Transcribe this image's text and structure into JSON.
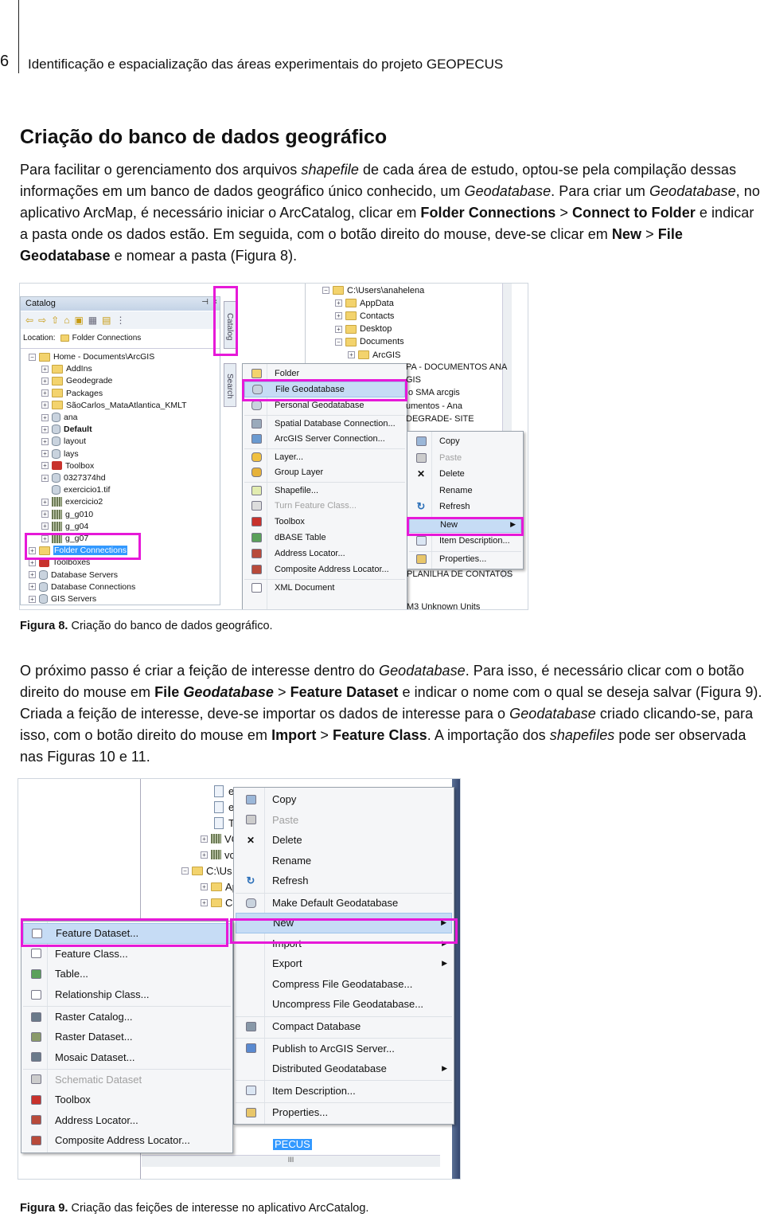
{
  "header": {
    "page_number": "6",
    "running_title": "Identificação e espacialização das áreas experimentais do projeto GEOPECUS"
  },
  "section_title": "Criação do banco de dados geográfico",
  "paragraph1": [
    {
      "t": "Para facilitar o gerenciamento dos arquivos ",
      "s": ""
    },
    {
      "t": "shapefile",
      "s": "i"
    },
    {
      "t": " de cada área de estudo, optou-se pela compilação dessas informações em um banco de dados geográfico único conhecido, um ",
      "s": ""
    },
    {
      "t": "Geodatabase",
      "s": "i"
    },
    {
      "t": ". Para criar um ",
      "s": ""
    },
    {
      "t": "Geodatabase",
      "s": "i"
    },
    {
      "t": ", no aplicativo ArcMap, é necessário iniciar o ArcCatalog, clicar em ",
      "s": ""
    },
    {
      "t": "Folder Connections",
      "s": "b"
    },
    {
      "t": " > ",
      "s": ""
    },
    {
      "t": "Connect to Folder",
      "s": "b"
    },
    {
      "t": " e indicar a pasta onde os dados estão. Em seguida, com o botão direito do mouse, deve-se clicar em ",
      "s": ""
    },
    {
      "t": "New",
      "s": "b"
    },
    {
      "t": " > ",
      "s": ""
    },
    {
      "t": "File Geodatabase",
      "s": "b"
    },
    {
      "t": " e nomear a pasta (Figura 8).",
      "s": ""
    }
  ],
  "paragraph2": [
    {
      "t": "O próximo passo é criar a feição de interesse dentro do ",
      "s": ""
    },
    {
      "t": "Geodatabase",
      "s": "i"
    },
    {
      "t": ". Para isso, é necessário clicar com o botão direito do mouse em ",
      "s": ""
    },
    {
      "t": "File ",
      "s": "b"
    },
    {
      "t": "Geodatabase",
      "s": "bi"
    },
    {
      "t": " > ",
      "s": ""
    },
    {
      "t": "Feature Dataset",
      "s": "b"
    },
    {
      "t": " e indicar o nome com o qual se deseja salvar (Figura 9). Criada a feição de interesse, deve-se importar os dados de interesse para o ",
      "s": ""
    },
    {
      "t": "Geodatabase",
      "s": "i"
    },
    {
      "t": " criado clicando-se, para isso, com o botão direito do mouse em ",
      "s": ""
    },
    {
      "t": "Import",
      "s": "b"
    },
    {
      "t": " > ",
      "s": ""
    },
    {
      "t": "Feature Class",
      "s": "b"
    },
    {
      "t": ". A importação dos ",
      "s": ""
    },
    {
      "t": "shapefiles",
      "s": "i"
    },
    {
      "t": " pode ser observada nas Figuras 10 e 11.",
      "s": ""
    }
  ],
  "figure8": {
    "caption_label": "Figura 8.",
    "caption_text": " Criação do banco de dados geográfico.",
    "catalog": {
      "title": "Catalog",
      "location_label": "Location:",
      "location_value": "Folder Connections",
      "tab_catalog": "Catalog",
      "tab_search": "Search",
      "tree": [
        {
          "label": "Home - Documents\\ArcGIS",
          "icon": "home-folder",
          "exp": "-",
          "lvl": 0
        },
        {
          "label": "AddIns",
          "icon": "folder",
          "exp": "+",
          "lvl": 1
        },
        {
          "label": "Geodegrade",
          "icon": "folder",
          "exp": "+",
          "lvl": 1
        },
        {
          "label": "Packages",
          "icon": "folder",
          "exp": "+",
          "lvl": 1
        },
        {
          "label": "SãoCarlos_MataAtlantica_KMLT",
          "icon": "folder",
          "exp": "+",
          "lvl": 1
        },
        {
          "label": "ana",
          "icon": "geodatabase",
          "exp": "+",
          "lvl": 1
        },
        {
          "label": "Default",
          "icon": "geodatabase",
          "exp": "+",
          "lvl": 1,
          "bold": true
        },
        {
          "label": "layout",
          "icon": "geodatabase",
          "exp": "+",
          "lvl": 1
        },
        {
          "label": "lays",
          "icon": "geodatabase",
          "exp": "+",
          "lvl": 1
        },
        {
          "label": "Toolbox",
          "icon": "toolbox",
          "exp": "+",
          "lvl": 1
        },
        {
          "label": "0327374hd",
          "icon": "coverage",
          "exp": "+",
          "lvl": 1
        },
        {
          "label": "exercicio1.tif",
          "icon": "raster-file",
          "exp": "",
          "lvl": 1
        },
        {
          "label": "exercicio2",
          "icon": "raster",
          "exp": "+",
          "lvl": 1
        },
        {
          "label": "g_g010",
          "icon": "raster",
          "exp": "+",
          "lvl": 1
        },
        {
          "label": "g_g04",
          "icon": "raster",
          "exp": "+",
          "lvl": 1
        },
        {
          "label": "g_g07",
          "icon": "raster",
          "exp": "+",
          "lvl": 1
        },
        {
          "label": "Folder Connections",
          "icon": "folder-connection",
          "exp": "+",
          "lvl": 0,
          "selected": true
        },
        {
          "label": "Toolboxes",
          "icon": "toolbox",
          "exp": "+",
          "lvl": 0
        },
        {
          "label": "Database Servers",
          "icon": "database-server",
          "exp": "+",
          "lvl": 0
        },
        {
          "label": "Database Connections",
          "icon": "database-connection",
          "exp": "+",
          "lvl": 0
        },
        {
          "label": "GIS Servers",
          "icon": "gis-server",
          "exp": "+",
          "lvl": 0
        }
      ]
    },
    "background_tree": [
      {
        "label": "C:\\Users\\anahelena",
        "exp": "-"
      },
      {
        "label": "AppData",
        "exp": "+"
      },
      {
        "label": "Contacts",
        "exp": "+"
      },
      {
        "label": "Desktop",
        "exp": "+"
      },
      {
        "label": "Documents",
        "exp": "-"
      },
      {
        "label": "ArcGIS",
        "exp": "+"
      }
    ],
    "background_fragments": [
      "PA - DOCUMENTOS ANA",
      "GIS",
      "o SMA arcgis",
      "umentos - Ana",
      "DEGRADE- SITE",
      "PLANILHA DE CONTATOS",
      "M3 Unknown Units"
    ],
    "new_submenu": [
      {
        "label": "Folder",
        "icon": "folder"
      },
      {
        "label": "File Geodatabase",
        "icon": "geodatabase",
        "highlight": true
      },
      {
        "label": "Personal Geodatabase",
        "icon": "geodatabase"
      },
      {
        "label": "Spatial Database Connection...",
        "icon": "database-connection",
        "sep": true
      },
      {
        "label": "ArcGIS Server Connection...",
        "icon": "gis-server"
      },
      {
        "label": "Layer...",
        "icon": "layer",
        "sep": true
      },
      {
        "label": "Group Layer",
        "icon": "group-layer"
      },
      {
        "label": "Shapefile...",
        "icon": "shapefile",
        "sep": true
      },
      {
        "label": "Turn Feature Class...",
        "icon": "turn-feature",
        "disabled": true
      },
      {
        "label": "Toolbox",
        "icon": "toolbox"
      },
      {
        "label": "dBASE Table",
        "icon": "table"
      },
      {
        "label": "Address Locator...",
        "icon": "address-locator"
      },
      {
        "label": "Composite Address Locator...",
        "icon": "address-locator"
      },
      {
        "label": "XML Document",
        "icon": "xml",
        "sep": true
      }
    ],
    "context_menu": [
      {
        "label": "Copy",
        "icon": "copy"
      },
      {
        "label": "Paste",
        "icon": "paste",
        "disabled": true
      },
      {
        "label": "Delete",
        "icon": "delete"
      },
      {
        "label": "Rename",
        "icon": ""
      },
      {
        "label": "Refresh",
        "icon": "refresh"
      },
      {
        "label": "New",
        "icon": "",
        "highlight": true,
        "submenu": true,
        "sep": true
      },
      {
        "label": "Item Description...",
        "icon": "document"
      },
      {
        "label": "Properties...",
        "icon": "properties",
        "sep": true
      }
    ]
  },
  "figure9": {
    "caption_label": "Figura 9.",
    "caption_text": " Criação das feições de interesse no aplicativo ArcCatalog.",
    "background_tree": [
      "eu",
      "eu",
      "Tit",
      "VC",
      "vc",
      "C:\\Us",
      "Ap",
      "Co"
    ],
    "selected_item": "PECUS",
    "scroll_mark": "III",
    "context_menu": [
      {
        "label": "Copy",
        "icon": "copy"
      },
      {
        "label": "Paste",
        "icon": "paste",
        "disabled": true
      },
      {
        "label": "Delete",
        "icon": "delete"
      },
      {
        "label": "Rename",
        "icon": ""
      },
      {
        "label": "Refresh",
        "icon": "refresh"
      },
      {
        "label": "Make Default Geodatabase",
        "icon": "default-geodatabase",
        "sep": true
      },
      {
        "label": "New",
        "icon": "",
        "highlight": true,
        "submenu": true
      },
      {
        "label": "Import",
        "icon": "",
        "submenu": true
      },
      {
        "label": "Export",
        "icon": "",
        "submenu": true
      },
      {
        "label": "Compress File Geodatabase...",
        "icon": ""
      },
      {
        "label": "Uncompress File Geodatabase...",
        "icon": ""
      },
      {
        "label": "Compact Database",
        "icon": "compact",
        "sep": true
      },
      {
        "label": "Publish to ArcGIS Server...",
        "icon": "publish",
        "sep": true
      },
      {
        "label": "Distributed Geodatabase",
        "icon": "",
        "submenu": true
      },
      {
        "label": "Item Description...",
        "icon": "document",
        "sep": true
      },
      {
        "label": "Properties...",
        "icon": "properties",
        "sep": true
      }
    ],
    "new_submenu": [
      {
        "label": "Feature Dataset...",
        "icon": "feature-dataset",
        "highlight": true
      },
      {
        "label": "Feature Class...",
        "icon": "feature-class"
      },
      {
        "label": "Table...",
        "icon": "table"
      },
      {
        "label": "Relationship Class...",
        "icon": "relationship-class"
      },
      {
        "label": "Raster Catalog...",
        "icon": "raster-catalog",
        "sep": true
      },
      {
        "label": "Raster Dataset...",
        "icon": "raster"
      },
      {
        "label": "Mosaic Dataset...",
        "icon": "mosaic"
      },
      {
        "label": "Schematic Dataset",
        "icon": "schematic",
        "disabled": true,
        "sep": true
      },
      {
        "label": "Toolbox",
        "icon": "toolbox"
      },
      {
        "label": "Address Locator...",
        "icon": "address-locator"
      },
      {
        "label": "Composite Address Locator...",
        "icon": "address-locator"
      }
    ]
  },
  "colors": {
    "highlight_box": "#e619d8",
    "menu_highlight": "#c6dcf5",
    "selection": "#3399ff"
  }
}
